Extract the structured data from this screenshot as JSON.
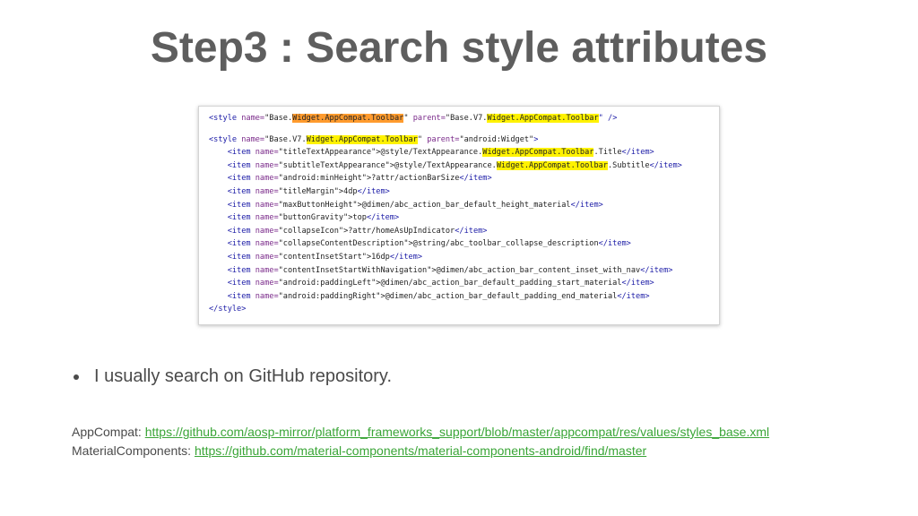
{
  "slide": {
    "title": "Step3 : Search style attributes",
    "bullet": "I usually search on GitHub repository.",
    "links": [
      {
        "label": "AppCompat:",
        "url": "https://github.com/aosp-mirror/platform_frameworks_support/blob/master/appcompat/res/values/styles_base.xml"
      },
      {
        "label": "MaterialComponents:",
        "url": "https://github.com/material-components/material-components-android/find/master"
      }
    ]
  },
  "code": {
    "highlight_colors": {
      "primary": "#ff9b2e",
      "secondary": "#fff200"
    },
    "lines": [
      [
        {
          "t": "<style ",
          "c": "tag"
        },
        {
          "t": "name=",
          "c": "attr"
        },
        {
          "t": "\"Base.",
          "c": "str"
        },
        {
          "t": "Widget.AppCompat.Toolbar",
          "c": "str",
          "h": "orange"
        },
        {
          "t": "\" ",
          "c": "str"
        },
        {
          "t": "parent=",
          "c": "attr"
        },
        {
          "t": "\"Base.V7.",
          "c": "str"
        },
        {
          "t": "Widget.AppCompat.Toolbar",
          "c": "str",
          "h": "yellow"
        },
        {
          "t": "\" />",
          "c": "tag"
        }
      ],
      [],
      [
        {
          "t": "<style ",
          "c": "tag"
        },
        {
          "t": "name=",
          "c": "attr"
        },
        {
          "t": "\"Base.V7.",
          "c": "str"
        },
        {
          "t": "Widget.AppCompat.Toolbar",
          "c": "str",
          "h": "yellow"
        },
        {
          "t": "\" ",
          "c": "str"
        },
        {
          "t": "parent=",
          "c": "attr"
        },
        {
          "t": "\"android:Widget\"",
          "c": "str"
        },
        {
          "t": ">",
          "c": "tag"
        }
      ],
      [
        {
          "t": "    <item ",
          "c": "tag"
        },
        {
          "t": "name=",
          "c": "attr"
        },
        {
          "t": "\"titleTextAppearance\"",
          "c": "str"
        },
        {
          "t": ">@style/TextAppearance.",
          "c": "str"
        },
        {
          "t": "Widget.AppCompat.Toolbar",
          "c": "str",
          "h": "yellow"
        },
        {
          "t": ".Title",
          "c": "str"
        },
        {
          "t": "</item>",
          "c": "tag"
        }
      ],
      [
        {
          "t": "    <item ",
          "c": "tag"
        },
        {
          "t": "name=",
          "c": "attr"
        },
        {
          "t": "\"subtitleTextAppearance\"",
          "c": "str"
        },
        {
          "t": ">@style/TextAppearance.",
          "c": "str"
        },
        {
          "t": "Widget.AppCompat.Toolbar",
          "c": "str",
          "h": "yellow"
        },
        {
          "t": ".Subtitle",
          "c": "str"
        },
        {
          "t": "</item>",
          "c": "tag"
        }
      ],
      [
        {
          "t": "    <item ",
          "c": "tag"
        },
        {
          "t": "name=",
          "c": "attr"
        },
        {
          "t": "\"android:minHeight\"",
          "c": "str"
        },
        {
          "t": ">?attr/actionBarSize",
          "c": "str"
        },
        {
          "t": "</item>",
          "c": "tag"
        }
      ],
      [
        {
          "t": "    <item ",
          "c": "tag"
        },
        {
          "t": "name=",
          "c": "attr"
        },
        {
          "t": "\"titleMargin\"",
          "c": "str"
        },
        {
          "t": ">4dp",
          "c": "str"
        },
        {
          "t": "</item>",
          "c": "tag"
        }
      ],
      [
        {
          "t": "    <item ",
          "c": "tag"
        },
        {
          "t": "name=",
          "c": "attr"
        },
        {
          "t": "\"maxButtonHeight\"",
          "c": "str"
        },
        {
          "t": ">@dimen/abc_action_bar_default_height_material",
          "c": "str"
        },
        {
          "t": "</item>",
          "c": "tag"
        }
      ],
      [
        {
          "t": "    <item ",
          "c": "tag"
        },
        {
          "t": "name=",
          "c": "attr"
        },
        {
          "t": "\"buttonGravity\"",
          "c": "str"
        },
        {
          "t": ">top",
          "c": "str"
        },
        {
          "t": "</item>",
          "c": "tag"
        }
      ],
      [
        {
          "t": "    <item ",
          "c": "tag"
        },
        {
          "t": "name=",
          "c": "attr"
        },
        {
          "t": "\"collapseIcon\"",
          "c": "str"
        },
        {
          "t": ">?attr/homeAsUpIndicator",
          "c": "str"
        },
        {
          "t": "</item>",
          "c": "tag"
        }
      ],
      [
        {
          "t": "    <item ",
          "c": "tag"
        },
        {
          "t": "name=",
          "c": "attr"
        },
        {
          "t": "\"collapseContentDescription\"",
          "c": "str"
        },
        {
          "t": ">@string/abc_toolbar_collapse_description",
          "c": "str"
        },
        {
          "t": "</item>",
          "c": "tag"
        }
      ],
      [
        {
          "t": "    <item ",
          "c": "tag"
        },
        {
          "t": "name=",
          "c": "attr"
        },
        {
          "t": "\"contentInsetStart\"",
          "c": "str"
        },
        {
          "t": ">16dp",
          "c": "str"
        },
        {
          "t": "</item>",
          "c": "tag"
        }
      ],
      [
        {
          "t": "    <item ",
          "c": "tag"
        },
        {
          "t": "name=",
          "c": "attr"
        },
        {
          "t": "\"contentInsetStartWithNavigation\"",
          "c": "str"
        },
        {
          "t": ">@dimen/abc_action_bar_content_inset_with_nav",
          "c": "str"
        },
        {
          "t": "</item>",
          "c": "tag"
        }
      ],
      [
        {
          "t": "    <item ",
          "c": "tag"
        },
        {
          "t": "name=",
          "c": "attr"
        },
        {
          "t": "\"android:paddingLeft\"",
          "c": "str"
        },
        {
          "t": ">@dimen/abc_action_bar_default_padding_start_material",
          "c": "str"
        },
        {
          "t": "</item>",
          "c": "tag"
        }
      ],
      [
        {
          "t": "    <item ",
          "c": "tag"
        },
        {
          "t": "name=",
          "c": "attr"
        },
        {
          "t": "\"android:paddingRight\"",
          "c": "str"
        },
        {
          "t": ">@dimen/abc_action_bar_default_padding_end_material",
          "c": "str"
        },
        {
          "t": "</item>",
          "c": "tag"
        }
      ],
      [
        {
          "t": "</style>",
          "c": "tag"
        }
      ]
    ]
  }
}
